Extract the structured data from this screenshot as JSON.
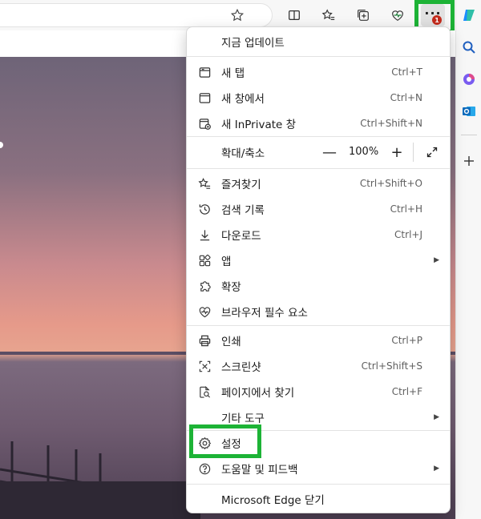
{
  "toolbar": {
    "icons": [
      "favorite-star-icon",
      "split-screen-icon",
      "favorites-icon",
      "collections-icon",
      "browser-essentials-icon",
      "more-icon"
    ],
    "notification_count": "1"
  },
  "sidebar": {
    "icons": [
      "copilot-icon",
      "search-icon",
      "office-icon",
      "outlook-icon",
      "add-icon"
    ]
  },
  "menu": {
    "update": "지금 업데이트",
    "new_tab": {
      "label": "새 탭",
      "shortcut": "Ctrl+T"
    },
    "new_window": {
      "label": "새 창에서",
      "shortcut": "Ctrl+N"
    },
    "new_inprivate": {
      "label": "새 InPrivate 창",
      "shortcut": "Ctrl+Shift+N"
    },
    "zoom": {
      "label": "확대/축소",
      "minus": "—",
      "value": "100%",
      "plus": "+"
    },
    "favorites": {
      "label": "즐겨찾기",
      "shortcut": "Ctrl+Shift+O"
    },
    "history": {
      "label": "검색 기록",
      "shortcut": "Ctrl+H"
    },
    "downloads": {
      "label": "다운로드",
      "shortcut": "Ctrl+J"
    },
    "apps": {
      "label": "앱"
    },
    "extensions": {
      "label": "확장"
    },
    "essentials": {
      "label": "브라우저 필수 요소"
    },
    "print": {
      "label": "인쇄",
      "shortcut": "Ctrl+P"
    },
    "screenshot": {
      "label": "스크린샷",
      "shortcut": "Ctrl+Shift+S"
    },
    "find": {
      "label": "페이지에서 찾기",
      "shortcut": "Ctrl+F"
    },
    "more_tools": {
      "label": "기타 도구"
    },
    "settings": {
      "label": "설정"
    },
    "help": {
      "label": "도움말 및 피드백"
    },
    "close": {
      "label": "Microsoft Edge 닫기"
    }
  },
  "colors": {
    "highlight": "#1db336",
    "badge": "#c42b1c"
  }
}
